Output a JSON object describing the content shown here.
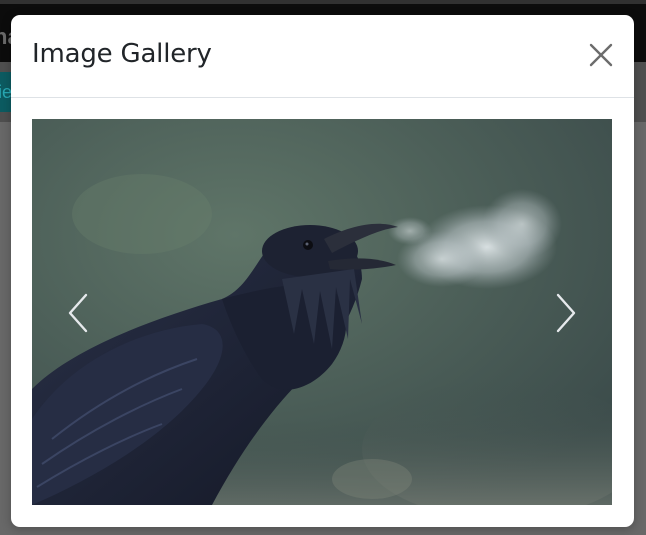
{
  "modal": {
    "title": "Image Gallery",
    "close_icon": "close-icon"
  },
  "carousel": {
    "prev_icon": "chevron-left-icon",
    "next_icon": "chevron-right-icon"
  },
  "background": {
    "topbar_fragment": "ha",
    "tab_fragment": "ie"
  }
}
